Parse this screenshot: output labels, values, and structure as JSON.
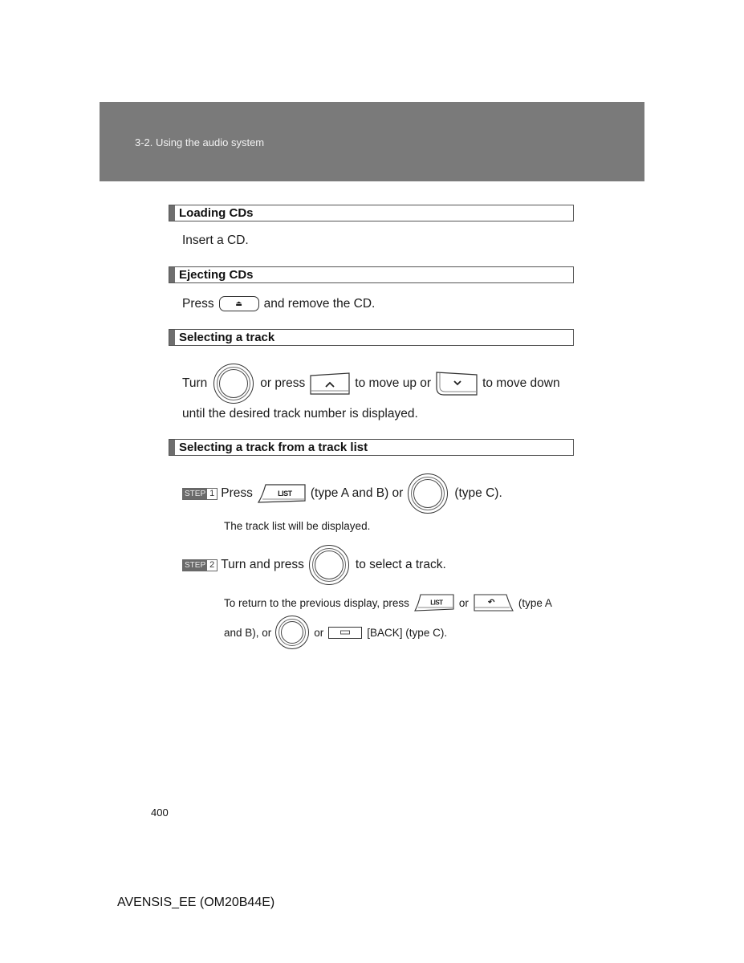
{
  "header": {
    "breadcrumb": "3-2. Using the audio system"
  },
  "sections": [
    {
      "title": "Loading CDs",
      "body": "Insert a CD."
    },
    {
      "title": "Ejecting CDs",
      "body_before": "Press",
      "body_after": "and remove the CD."
    },
    {
      "title": "Selecting a track",
      "line1": {
        "turn": "Turn",
        "or_press": "or press",
        "move_up": "to move up or",
        "move_down": "to move down"
      },
      "line2": "until the desired track number is displayed."
    },
    {
      "title": "Selecting a track from a track list",
      "step1": {
        "badge": "STEP",
        "num": "1",
        "press": "Press",
        "type_ab": "(type A and B) or",
        "type_c": "(type C).",
        "note": "The track list will be displayed."
      },
      "step2": {
        "badge": "STEP",
        "num": "2",
        "turn_press": "Turn and press",
        "select": "to select a track.",
        "note_before": "To return to the previous display, press",
        "note_or": "or",
        "note_type_a": "(type A",
        "note2_start": "and B), or",
        "note2_or": "or",
        "note2_end": "[BACK] (type C)."
      }
    }
  ],
  "buttons": {
    "list": "LIST",
    "eject_icon": "⏏",
    "up_icon": "^",
    "down_icon": "v",
    "back_icon": "↶"
  },
  "page_number": "400",
  "footer": "AVENSIS_EE (OM20B44E)"
}
